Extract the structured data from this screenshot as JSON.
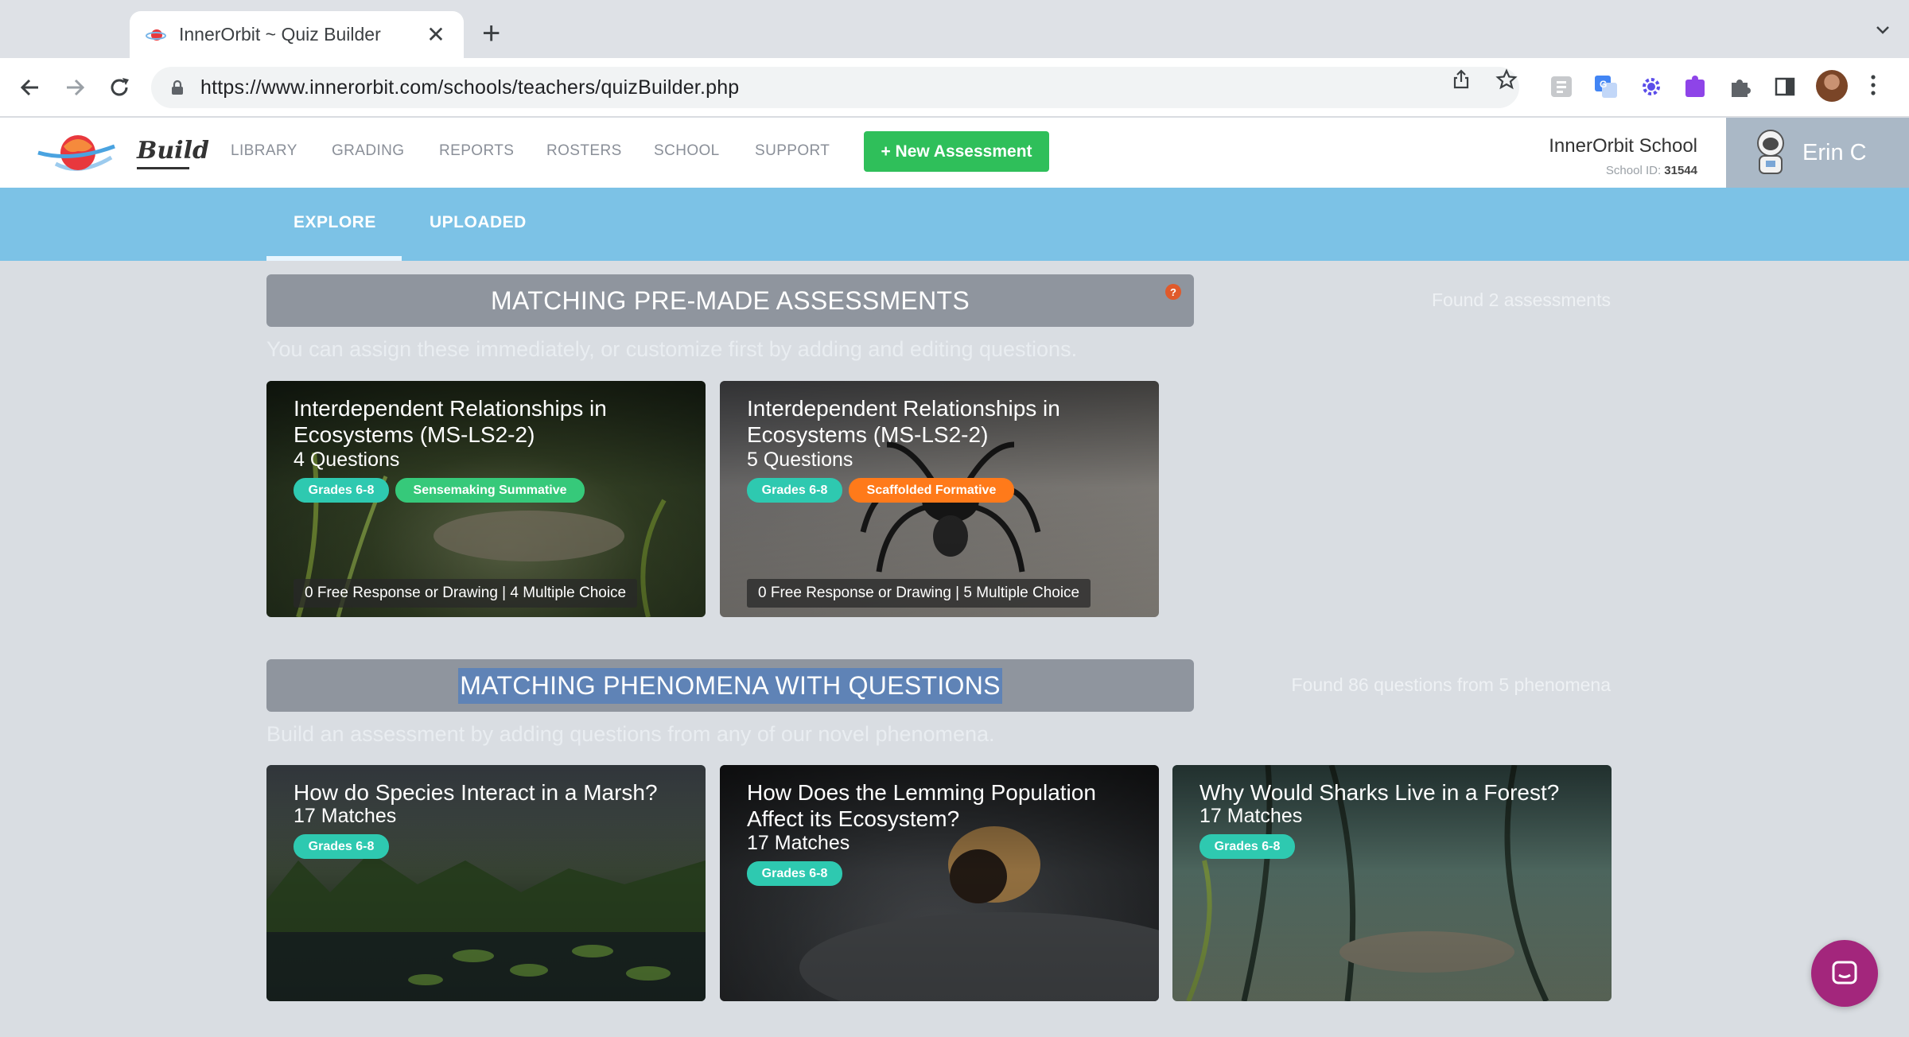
{
  "browser": {
    "tab_title": "InnerOrbit ~ Quiz Builder",
    "url": "https://www.innerorbit.com/schools/teachers/quizBuilder.php"
  },
  "header": {
    "brand": "Build",
    "nav": [
      "LIBRARY",
      "GRADING",
      "REPORTS",
      "ROSTERS",
      "SCHOOL",
      "SUPPORT"
    ],
    "new_assessment": "+ New Assessment",
    "school_name": "InnerOrbit School",
    "school_id_label": "School ID:",
    "school_id": "31544",
    "user_name": "Erin C"
  },
  "subnav": {
    "tabs": [
      "EXPLORE",
      "UPLOADED"
    ],
    "active": "EXPLORE"
  },
  "premade": {
    "title": "MATCHING PRE-MADE ASSESSMENTS",
    "help": "?",
    "found": "Found 2 assessments",
    "subtitle": "You can assign these immediately, or customize first by adding and editing questions.",
    "cards": [
      {
        "title": "Interdependent Relationships in Ecosystems (MS-LS2-2)",
        "count": "4 Questions",
        "grade": "Grades 6-8",
        "type": "Sensemaking Summative",
        "footer": "0 Free Response or Drawing | 4 Multiple Choice"
      },
      {
        "title": "Interdependent Relationships in Ecosystems (MS-LS2-2)",
        "count": "5 Questions",
        "grade": "Grades 6-8",
        "type": "Scaffolded Formative",
        "footer": "0 Free Response or Drawing | 5 Multiple Choice"
      }
    ]
  },
  "phenomena": {
    "title": "MATCHING PHENOMENA WITH QUESTIONS",
    "found": "Found 86 questions from 5 phenomena",
    "subtitle": "Build an assessment by adding questions from any of our novel phenomena.",
    "cards": [
      {
        "title": "How do Species Interact in a Marsh?",
        "count": "17 Matches",
        "grade": "Grades 6-8"
      },
      {
        "title": "How Does the Lemming Population Affect its Ecosystem?",
        "count": "17 Matches",
        "grade": "Grades 6-8"
      },
      {
        "title": "Why Would Sharks Live in a Forest?",
        "count": "17 Matches",
        "grade": "Grades 6-8"
      }
    ]
  },
  "colors": {
    "accent_green": "#2fbf5a",
    "subnav_blue": "#7cc2e6",
    "badge_teal": "#2ec9b0",
    "badge_orange": "#ff7a1a",
    "chat": "#a3267c"
  }
}
